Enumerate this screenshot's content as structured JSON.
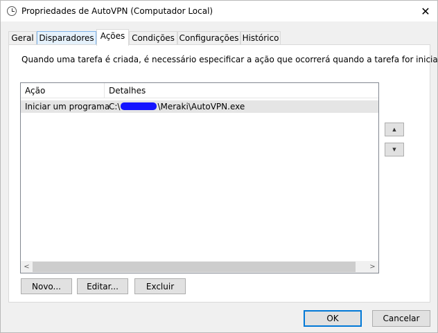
{
  "window": {
    "title": "Propriedades de AutoVPN (Computador Local)",
    "close_glyph": "✕"
  },
  "tabs": [
    {
      "label": "Geral"
    },
    {
      "label": "Disparadores"
    },
    {
      "label": "Ações"
    },
    {
      "label": "Condições"
    },
    {
      "label": "Configurações"
    },
    {
      "label": "Histórico"
    }
  ],
  "active_tab": "Ações",
  "panel": {
    "description": "Quando uma tarefa é criada, é necessário especificar a ação que ocorrerá quando a tarefa for iniciada.",
    "columns": [
      "Ação",
      "Detalhes"
    ],
    "rows": [
      {
        "action": "Iniciar um programa",
        "detail_prefix": "C:\\",
        "detail_suffix": "\\Meraki\\AutoVPN.exe"
      }
    ],
    "move_up_glyph": "▲",
    "move_down_glyph": "▼",
    "scroll_left_glyph": "<",
    "scroll_right_glyph": ">",
    "buttons": {
      "new": "Novo...",
      "edit": "Editar...",
      "delete": "Excluir"
    }
  },
  "footer": {
    "ok": "OK",
    "cancel": "Cancelar"
  },
  "colors": {
    "accent": "#0078d7",
    "redaction": "#1414ff"
  }
}
